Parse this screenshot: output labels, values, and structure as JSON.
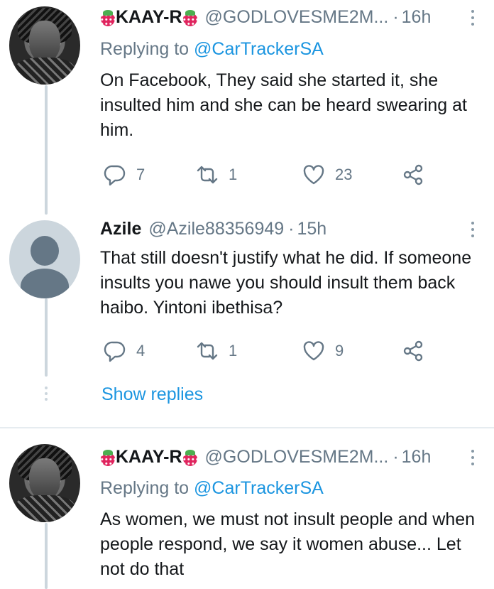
{
  "tweets": [
    {
      "name": "KAAY-R",
      "handle": "@GODLOVESME2M...",
      "separator": "·",
      "time": "16h",
      "reply_prefix": "Replying to ",
      "reply_to": "@CarTrackerSA",
      "text": "On Facebook, They said she started it, she insulted him and she can be heard swearing at him.",
      "replies": "7",
      "retweets": "1",
      "likes": "23"
    },
    {
      "name": "Azile",
      "handle": "@Azile88356949",
      "separator": "·",
      "time": "15h",
      "text": "That still doesn't justify what he did. If someone insults you nawe you should insult them back haibo. Yintoni ibethisa?",
      "replies": "4",
      "retweets": "1",
      "likes": "9"
    },
    {
      "name": "KAAY-R",
      "handle": "@GODLOVESME2M...",
      "separator": "·",
      "time": "16h",
      "reply_prefix": "Replying to ",
      "reply_to": "@CarTrackerSA",
      "text": "As women, we must not insult people and when people respond, we say it women abuse... Let not do that"
    }
  ],
  "show_replies": "Show replies",
  "icons": [
    "strawberry-icon",
    "more-icon",
    "reply-icon",
    "retweet-icon",
    "like-icon",
    "share-icon"
  ],
  "colors": {
    "link": "#1b95e0",
    "secondary": "#657786",
    "text": "#14171a",
    "thread": "#ccd6dd"
  }
}
